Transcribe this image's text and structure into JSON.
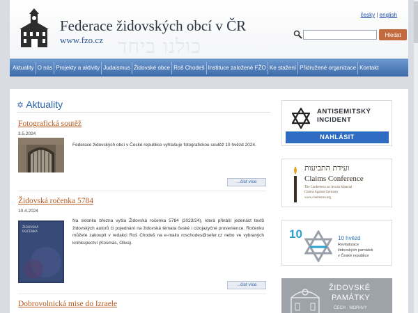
{
  "header": {
    "title": "Federace židovských obcí v ČR",
    "url": "www.fzo.cz",
    "hebrew": "כולנו ביחד",
    "lang_cz": "česky",
    "lang_sep": " | ",
    "lang_en": "english",
    "search_placeholder": "",
    "search_button": "Hledat"
  },
  "nav": {
    "items": [
      "Aktuality",
      "O nás",
      "Projekty a aktivity",
      "Judaismus",
      "Židovské obce",
      "Roš Chodeš",
      "Instituce založené FŽO",
      "Ke stažení",
      "Přidružené organizace",
      "Kontakt"
    ]
  },
  "main": {
    "section_star": "✡",
    "section_title": "Aktuality",
    "articles": [
      {
        "title": "Fotografická soutěž",
        "date": "3.5.2024",
        "text": "Federace židovských obcí v České republice vyhlašuje fotografickou soutěž 10 hvězd 2024.",
        "more": "...čist více"
      },
      {
        "title": "Židovská ročenka 5784",
        "date": "10.4.2024",
        "text": "Na sklonku března vyšla Židovská ročenka 5784 (2023/24), která přináší jedenáct textů židovských autorů či pojednání na židovská témata české i cizojazyčné provenience. Ročenku můžete zakoupit v redakci Roš Chodeš na e-mailu roschodes@sefer.cz nebo ve vybraných knihkupectví (Kosmas, Oliva).",
        "more": "...čist více",
        "book_label_1": "ŽIDOVSKÁ",
        "book_label_2": "ROČENKA"
      },
      {
        "title": "Dobrovolnická mise do Izraele"
      }
    ]
  },
  "sidebar": {
    "banner1": {
      "line1": "ANTISEMITSKÝ",
      "line2": "INCIDENT",
      "button": "NAHLÁSIT"
    },
    "banner2": {
      "hebrew": "ועידת התביעות",
      "title": "Claims Conference",
      "sub1": "The Conference on Jewish Material",
      "sub2": "Claims Against Germany",
      "sub3": "www.claimscon.org"
    },
    "banner3": {
      "number": "10",
      "stars": "10 hvězd",
      "line1": "Revitalizace",
      "line2": "židovských památek",
      "line3": "v České republice"
    },
    "banner4": {
      "line1": "ŽIDOVSKÉ",
      "line2": "PAMÁTKY",
      "line3": "ČECH · MORAVY"
    }
  },
  "colors": {
    "nav": "#3d6aa8",
    "accent_orange": "#c36a3e",
    "article_title": "#b55a1f",
    "section_title": "#2b62a8",
    "report_button": "#2f6bc1"
  }
}
